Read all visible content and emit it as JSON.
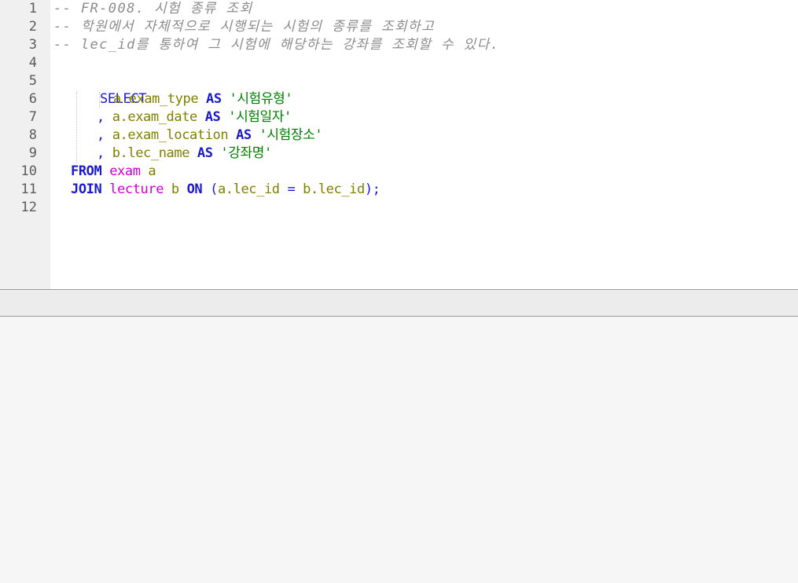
{
  "editor": {
    "line_numbers": [
      "1",
      "2",
      "3",
      "4",
      "5",
      "6",
      "7",
      "8",
      "9",
      "10",
      "11",
      "12"
    ],
    "lines": {
      "l1": "-- FR-008. 시험 종류 조회",
      "l2": "-- 학원에서 자체적으로 시행되는 시험의 종류를 조회하고",
      "l3": "-- lec_id를 통하여 그 시험에 해당하는 강좌를 조회할 수 있다.",
      "l5_select": "SELECT",
      "l6_ident": "a.exam_type",
      "l6_as": "AS",
      "l6_str": "'시험유형'",
      "l7_comma": ",",
      "l7_ident": "a.exam_date",
      "l7_as": "AS",
      "l7_str": "'시험일자'",
      "l8_comma": ",",
      "l8_ident": "a.exam_location",
      "l8_as": "AS",
      "l8_str": "'시험장소'",
      "l9_comma": ",",
      "l9_ident": "b.lec_name",
      "l9_as": "AS",
      "l9_str": "'강좌명'",
      "l10_from": "FROM",
      "l10_table": "exam",
      "l10_alias": "a",
      "l11_join": "JOIN",
      "l11_table": "lecture",
      "l11_alias": "b",
      "l11_on": "ON",
      "l11_open": "(",
      "l11_left": "a.lec_id",
      "l11_eq": "=",
      "l11_right": "b.lec_id",
      "l11_close": ");"
    }
  },
  "colors": {
    "keyword": "#1a1acc",
    "identifier": "#808000",
    "table": "#d000d0",
    "string": "#008000",
    "comment": "#8c8c8c",
    "gutter_bg": "#f0f0f0",
    "editor_bg": "#ffffff",
    "result_bg": "#f6f6f6"
  }
}
